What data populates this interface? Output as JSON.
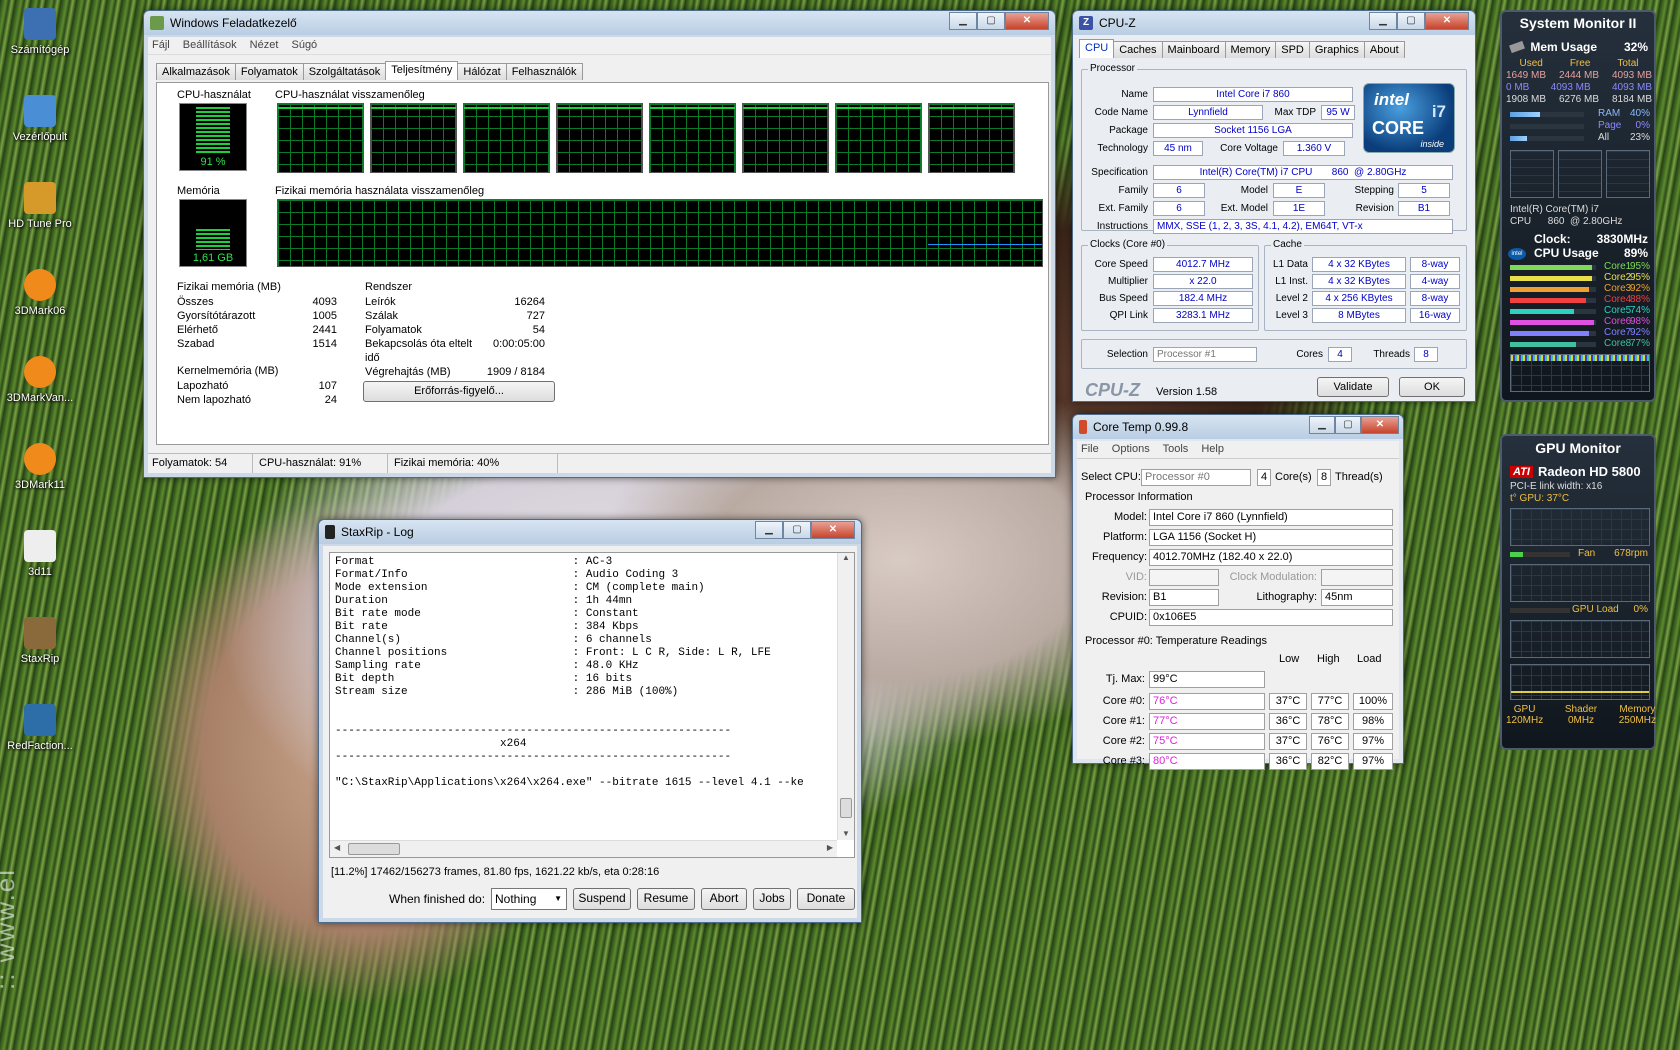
{
  "desktop_icons": [
    {
      "label": "Számítógép",
      "color": "#3d6fb3"
    },
    {
      "label": "Vezérlőpult",
      "color": "#4a8fd6"
    },
    {
      "label": "HD Tune Pro",
      "color": "#d69a2a"
    },
    {
      "label": "3DMark06",
      "color": "#f08a1a"
    },
    {
      "label": "3DMarkVan...",
      "color": "#f08a1a"
    },
    {
      "label": "3DMark11",
      "color": "#f08a1a"
    },
    {
      "label": "3d11",
      "color": "#eeeeee"
    },
    {
      "label": "StaxRip",
      "color": "#8a6a3a"
    },
    {
      "label": "RedFaction...",
      "color": "#2d6ea8"
    }
  ],
  "taskmgr": {
    "title": "Windows Feladatkezelő",
    "menu": [
      "Fájl",
      "Beállítások",
      "Nézet",
      "Súgó"
    ],
    "tabs": [
      "Alkalmazások",
      "Folyamatok",
      "Szolgáltatások",
      "Teljesítmény",
      "Hálózat",
      "Felhasználók"
    ],
    "cpu_label": "CPU-használat",
    "cpu_value": "91 %",
    "cpu_level": 0.91,
    "cpu_history_label": "CPU-használat visszamenőleg",
    "mem_label": "Memória",
    "mem_value": "1,61 GB",
    "mem_level": 0.4,
    "mem_history_label": "Fizikai memória használata visszamenőleg",
    "phys_title": "Fizikai memória (MB)",
    "phys": [
      {
        "k": "Összes",
        "v": "4093"
      },
      {
        "k": "Gyorsítótárazott",
        "v": "1005"
      },
      {
        "k": "Elérhető",
        "v": "2441"
      },
      {
        "k": "Szabad",
        "v": "1514"
      }
    ],
    "kernel_title": "Kernelmemória (MB)",
    "kernel": [
      {
        "k": "Lapozható",
        "v": "107"
      },
      {
        "k": "Nem lapozható",
        "v": "24"
      }
    ],
    "sys_title": "Rendszer",
    "sys": [
      {
        "k": "Leírók",
        "v": "16264"
      },
      {
        "k": "Szálak",
        "v": "727"
      },
      {
        "k": "Folyamatok",
        "v": "54"
      },
      {
        "k": "Bekapcsolás óta eltelt idő",
        "v": "0:00:05:00"
      },
      {
        "k": "Végrehajtás (MB)",
        "v": "1909 / 8184"
      }
    ],
    "resmon_button": "Erőforrás-figyelő...",
    "status": [
      "Folyamatok: 54",
      "CPU-használat: 91%",
      "Fizikai memória: 40%"
    ]
  },
  "cpuz": {
    "title": "CPU-Z",
    "tabs": [
      "CPU",
      "Caches",
      "Mainboard",
      "Memory",
      "SPD",
      "Graphics",
      "About"
    ],
    "processor_legend": "Processor",
    "name_l": "Name",
    "name": "Intel Core i7 860",
    "codename_l": "Code Name",
    "codename": "Lynnfield",
    "maxtdp_l": "Max TDP",
    "maxtdp": "95 W",
    "package_l": "Package",
    "package": "Socket 1156 LGA",
    "tech_l": "Technology",
    "tech": "45 nm",
    "cv_l": "Core Voltage",
    "cv": "1.360 V",
    "spec_l": "Specification",
    "spec": "Intel(R) Core(TM) i7 CPU       860  @ 2.80GHz",
    "family_l": "Family",
    "family": "6",
    "model_l": "Model",
    "model": "E",
    "stepping_l": "Stepping",
    "stepping": "5",
    "extfam_l": "Ext. Family",
    "extfam": "6",
    "extmodel_l": "Ext. Model",
    "extmodel": "1E",
    "revision_l": "Revision",
    "revision": "B1",
    "instr_l": "Instructions",
    "instr": "MMX, SSE (1, 2, 3, 3S, 4.1, 4.2), EM64T, VT-x",
    "clocks_legend": "Clocks (Core #0)",
    "clocks": [
      {
        "k": "Core Speed",
        "v": "4012.7 MHz"
      },
      {
        "k": "Multiplier",
        "v": "x 22.0"
      },
      {
        "k": "Bus Speed",
        "v": "182.4 MHz"
      },
      {
        "k": "QPI Link",
        "v": "3283.1 MHz"
      }
    ],
    "cache_legend": "Cache",
    "cache": [
      {
        "k": "L1 Data",
        "v": "4 x 32 KBytes",
        "w": "8-way"
      },
      {
        "k": "L1 Inst.",
        "v": "4 x 32 KBytes",
        "w": "4-way"
      },
      {
        "k": "Level 2",
        "v": "4 x 256 KBytes",
        "w": "8-way"
      },
      {
        "k": "Level 3",
        "v": "8 MBytes",
        "w": "16-way"
      }
    ],
    "selection_l": "Selection",
    "selection": "Processor #1",
    "cores_l": "Cores",
    "cores": "4",
    "threads_l": "Threads",
    "threads": "8",
    "logo": "CPU-Z",
    "version": "Version 1.58",
    "validate": "Validate",
    "ok": "OK",
    "intel_badge": {
      "brand": "intel",
      "line": "CORE",
      "model": "i7",
      "sub": "inside"
    }
  },
  "coretemp": {
    "title": "Core Temp 0.99.8",
    "menu": [
      "File",
      "Options",
      "Tools",
      "Help"
    ],
    "select_cpu_l": "Select CPU:",
    "select_cpu": "Processor #0",
    "cores_n": "4",
    "cores_l": "Core(s)",
    "threads_n": "8",
    "threads_l": "Thread(s)",
    "pinfo_title": "Processor Information",
    "model_l": "Model:",
    "model": "Intel Core i7 860 (Lynnfield)",
    "platform_l": "Platform:",
    "platform": "LGA 1156 (Socket H)",
    "freq_l": "Frequency:",
    "freq": "4012.70MHz (182.40 x 22.0)",
    "vid_l": "VID:",
    "clockmod_l": "Clock Modulation:",
    "rev_l": "Revision:",
    "rev": "B1",
    "litho_l": "Lithography:",
    "litho": "45nm",
    "cpuid_l": "CPUID:",
    "cpuid": "0x106E5",
    "temp_title": "Processor #0: Temperature Readings",
    "col_low": "Low",
    "col_high": "High",
    "col_load": "Load",
    "tjmax_l": "Tj. Max:",
    "tjmax": "99°C",
    "rows": [
      {
        "k": "Core #0:",
        "t": "76°C",
        "lo": "37°C",
        "hi": "77°C",
        "ld": "100%"
      },
      {
        "k": "Core #1:",
        "t": "77°C",
        "lo": "36°C",
        "hi": "78°C",
        "ld": "98%"
      },
      {
        "k": "Core #2:",
        "t": "75°C",
        "lo": "37°C",
        "hi": "76°C",
        "ld": "97%"
      },
      {
        "k": "Core #3:",
        "t": "80°C",
        "lo": "36°C",
        "hi": "82°C",
        "ld": "97%"
      }
    ]
  },
  "staxrip": {
    "title": "StaxRip - Log",
    "log": "Format                              : AC-3\nFormat/Info                         : Audio Coding 3\nMode extension                      : CM (complete main)\nDuration                            : 1h 44mn\nBit rate mode                       : Constant\nBit rate                            : 384 Kbps\nChannel(s)                          : 6 channels\nChannel positions                   : Front: L C R, Side: L R, LFE\nSampling rate                       : 48.0 KHz\nBit depth                           : 16 bits\nStream size                         : 286 MiB (100%)\n\n\n------------------------------------------------------------\n                         x264\n------------------------------------------------------------\n\n\"C:\\StaxRip\\Applications\\x264\\x264.exe\" --bitrate 1615 --level 4.1 --ke",
    "progress": "[11.2%] 17462/156273 frames, 81.80 fps, 1621.22 kb/s, eta 0:28:16",
    "when_l": "When finished do:",
    "when": "Nothing",
    "buttons": [
      "Suspend",
      "Resume",
      "Abort",
      "Jobs",
      "Donate"
    ]
  },
  "sysmon": {
    "title": "System Monitor II",
    "mem_l": "Mem Usage",
    "mem_pct": "32%",
    "cols": [
      "Used",
      "Free",
      "Total"
    ],
    "row1": [
      "1649 MB",
      "2444 MB",
      "4093 MB"
    ],
    "row2": [
      "0 MB",
      "4093 MB",
      "4093 MB"
    ],
    "row3": [
      "1908 MB",
      "6276 MB",
      "8184 MB"
    ],
    "bars": [
      {
        "k": "RAM",
        "v": "40%",
        "f": 0.4
      },
      {
        "k": "Page",
        "v": "0%",
        "f": 0.0
      },
      {
        "k": "All",
        "v": "23%",
        "f": 0.23
      }
    ],
    "cpu_name1": "Intel(R) Core(TM) i7",
    "cpu_name2": "CPU      860  @ 2.80GHz",
    "clock_l": "Clock:",
    "clock": "3830MHz",
    "cpu_l": "CPU Usage",
    "cpu_pct": "89%",
    "cores": [
      {
        "k": "Core1",
        "v": "95%",
        "f": 0.95,
        "c": "#7ed957"
      },
      {
        "k": "Core2",
        "v": "95%",
        "f": 0.95,
        "c": "#e8e04a"
      },
      {
        "k": "Core3",
        "v": "92%",
        "f": 0.92,
        "c": "#f0a030"
      },
      {
        "k": "Core4",
        "v": "88%",
        "f": 0.88,
        "c": "#f04040"
      },
      {
        "k": "Core5",
        "v": "74%",
        "f": 0.74,
        "c": "#30d0c0"
      },
      {
        "k": "Core6",
        "v": "98%",
        "f": 0.98,
        "c": "#e050e0"
      },
      {
        "k": "Core7",
        "v": "92%",
        "f": 0.92,
        "c": "#8080ff"
      },
      {
        "k": "Core8",
        "v": "77%",
        "f": 0.77,
        "c": "#40c0a0"
      }
    ]
  },
  "gpumon": {
    "title": "GPU Monitor",
    "brand": "ATI",
    "card": "Radeon HD 5800",
    "pcie": "PCI-E link width: x16",
    "temp": "t° GPU: 37°C",
    "fan_l": "Fan",
    "fan": "678rpm",
    "load_l": "GPU Load",
    "load": "0%",
    "gpu_l": "GPU",
    "gpu": "120MHz",
    "shader_l": "Shader",
    "shader": "0MHz",
    "memory_l": "Memory",
    "memory": "250MHz"
  },
  "watermark": ":: www.el"
}
